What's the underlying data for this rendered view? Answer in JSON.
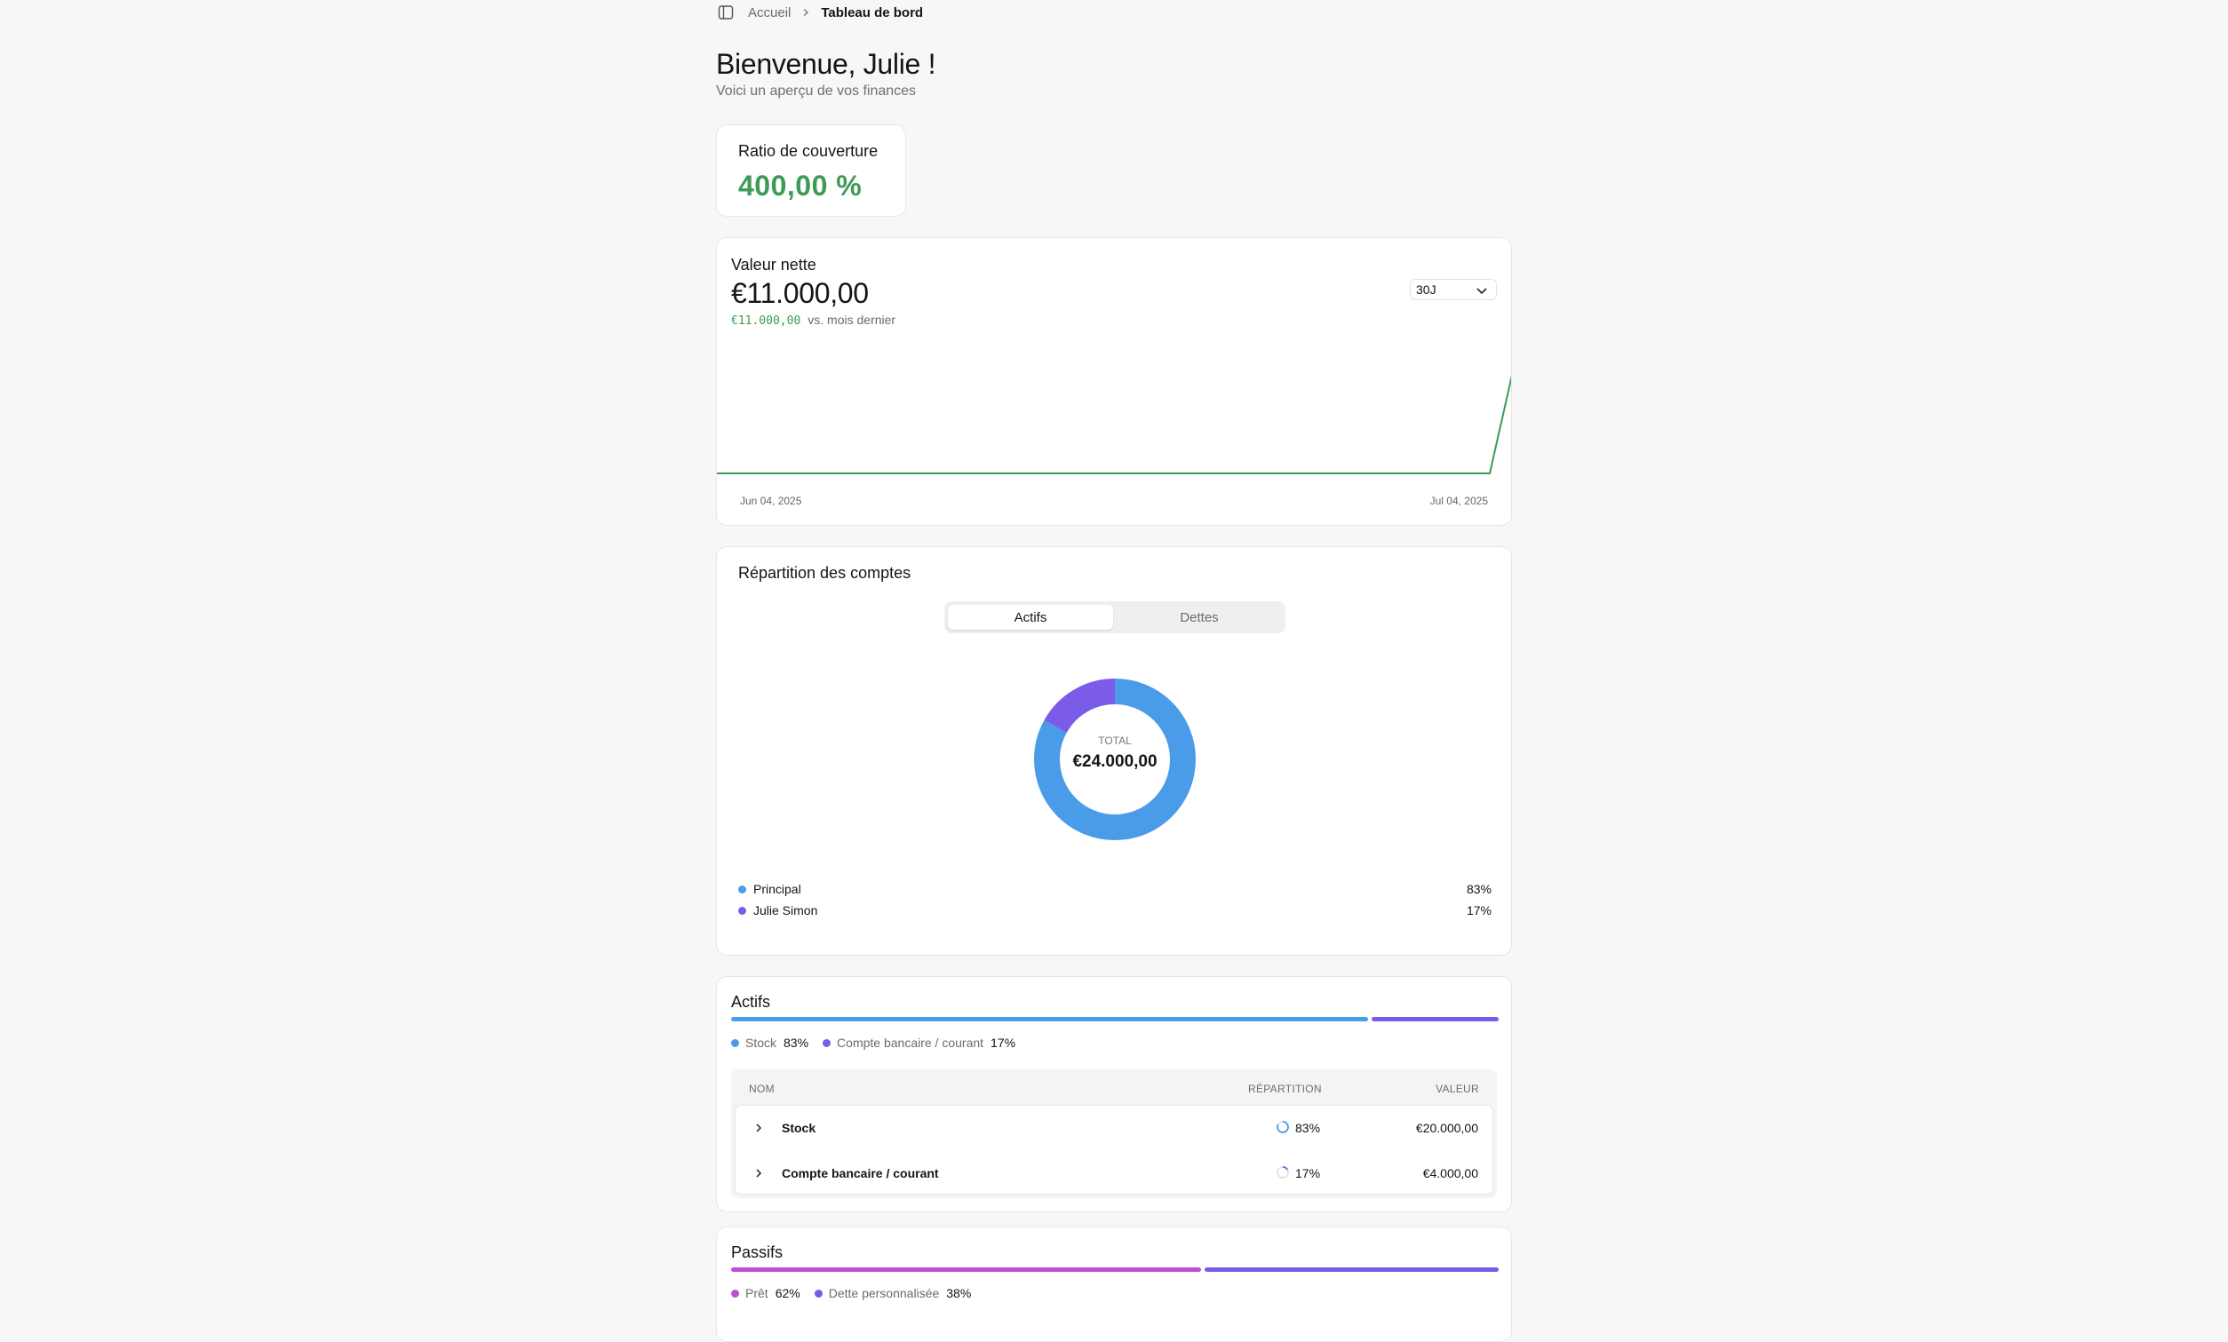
{
  "breadcrumb": {
    "home": "Accueil",
    "current": "Tableau de bord"
  },
  "header": {
    "title": "Bienvenue, Julie !",
    "subtitle": "Voici un aperçu de vos finances"
  },
  "ratio": {
    "label": "Ratio de couverture",
    "value": "400,00 %"
  },
  "net_worth": {
    "label": "Valeur nette",
    "value": "€11.000,00",
    "delta_value": "€11.000,00",
    "delta_text": "vs. mois dernier",
    "period": "30J",
    "date_start": "Jun 04, 2025",
    "date_end": "Jul 04, 2025"
  },
  "distribution": {
    "title": "Répartition des comptes",
    "tabs": [
      {
        "label": "Actifs",
        "active": true
      },
      {
        "label": "Dettes",
        "active": false
      }
    ],
    "total_label": "TOTAL",
    "total_value": "€24.000,00",
    "legend": [
      {
        "name": "Principal",
        "pct": "83%",
        "color": "#4a9be8"
      },
      {
        "name": "Julie Simon",
        "pct": "17%",
        "color": "#7b5ce8"
      }
    ]
  },
  "assets": {
    "title": "Actifs",
    "legend": [
      {
        "name": "Stock",
        "pct": "83%",
        "color": "#4a9be8"
      },
      {
        "name": "Compte bancaire / courant",
        "pct": "17%",
        "color": "#7b5ce8"
      }
    ],
    "table": {
      "headers": {
        "name": "NOM",
        "share": "RÉPARTITION",
        "value": "VALEUR"
      },
      "rows": [
        {
          "name": "Stock",
          "pct": "83%",
          "value": "€20.000,00"
        },
        {
          "name": "Compte bancaire / courant",
          "pct": "17%",
          "value": "€4.000,00"
        }
      ]
    }
  },
  "liabilities": {
    "title": "Passifs",
    "legend": [
      {
        "name": "Prêt",
        "pct": "62%",
        "color": "#c04ed4"
      },
      {
        "name": "Dette personnalisée",
        "pct": "38%",
        "color": "#7b5ce8"
      }
    ]
  },
  "colors": {
    "positive": "#3d9b57",
    "blue": "#4a9be8",
    "violet": "#7b5ce8",
    "magenta": "#c04ed4"
  },
  "chart_data": [
    {
      "type": "line",
      "x": [
        "Jun 04, 2025",
        "Jul 03, 2025",
        "Jul 04, 2025"
      ],
      "series": [
        {
          "values": [
            0,
            0,
            11000
          ]
        }
      ],
      "xlabel": "",
      "ylabel": "",
      "ylim": [
        0,
        11000
      ],
      "grid": false
    },
    {
      "type": "pie",
      "categories": [
        "Principal",
        "Julie Simon"
      ],
      "values": [
        83,
        17
      ]
    }
  ]
}
